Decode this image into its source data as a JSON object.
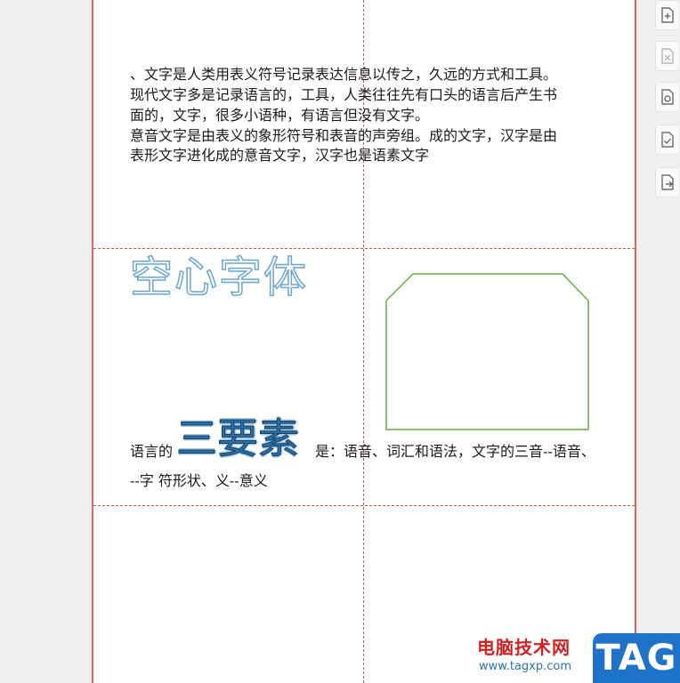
{
  "document": {
    "paragraphs": [
      "、文字是人类用表义符号记录表达信息以传之，久远的方式和工具。",
      "现代文字多是记录语言的，工具，人类往往先有口头的语言后产生书",
      "面的，文字，很多小语种，有语言但没有文字。",
      "意音文字是由表义的象形符号和表音的声旁组。成的文字，汉字是由",
      "表形文字进化成的意音文字，汉字也是语素文字"
    ],
    "hollow_text": "空心字体",
    "line_prefix": "语言的",
    "emphasis_text": "三要素",
    "line_suffix": "是：语音、词汇和语法，文字的三音--语音、",
    "line_second": "--字  符形状、义--意义"
  },
  "colors": {
    "page_border": "#e06666",
    "guide_line": "#e05050",
    "hollow_outline": "#6aa6d0",
    "shape_stroke": "#6aaa46",
    "emphasis": "#2a6fa8"
  },
  "toolbar": {
    "icons": [
      "add-page-icon",
      "delete-page-icon",
      "page-settings-icon",
      "check-page-icon",
      "export-page-icon"
    ]
  },
  "watermark": {
    "site_name": "电脑技术网",
    "url": "www.tagxp.com",
    "tag": "TAG"
  }
}
